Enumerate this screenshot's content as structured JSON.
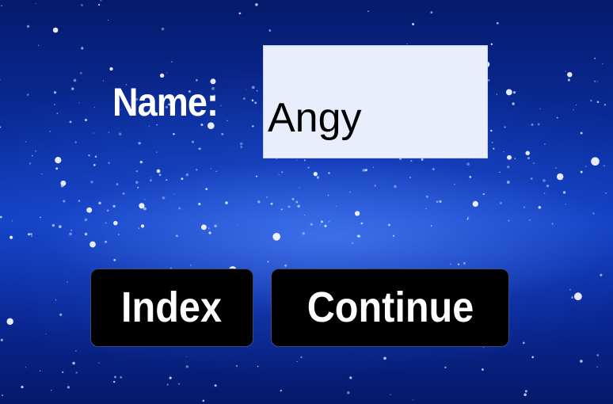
{
  "form": {
    "name_label": "Name:",
    "name_value": "Angy"
  },
  "buttons": {
    "index_label": "Index",
    "continue_label": "Continue"
  },
  "colors": {
    "input_background": "#e8eefc",
    "button_background": "#000000",
    "text_light": "#ffffff",
    "sky_blue": "#1240c4"
  }
}
